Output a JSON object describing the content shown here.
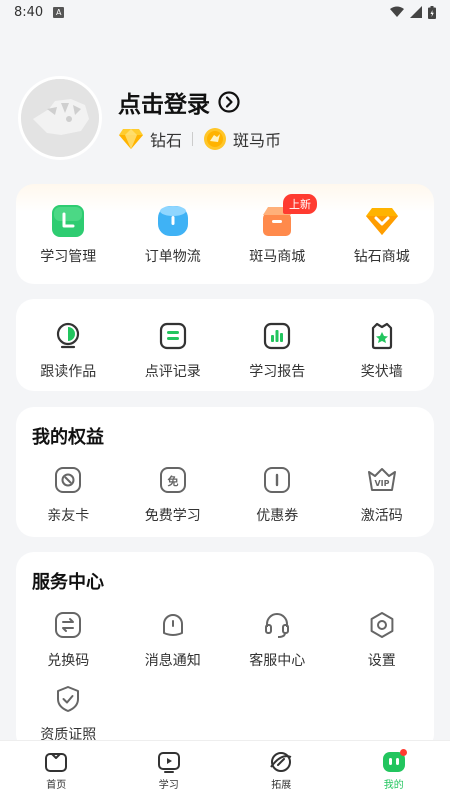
{
  "status_bar": {
    "time": "8:40",
    "notification": "A"
  },
  "profile": {
    "login_label": "点击登录",
    "diamond_label": "钻石",
    "coin_label": "斑马币"
  },
  "quick_menu": [
    {
      "label": "学习管理",
      "icon": "study-manage-icon"
    },
    {
      "label": "订单物流",
      "icon": "order-logistics-icon"
    },
    {
      "label": "斑马商城",
      "icon": "zebra-mall-icon",
      "badge": "上新"
    },
    {
      "label": "钻石商城",
      "icon": "diamond-mall-icon"
    }
  ],
  "works_menu": [
    {
      "label": "跟读作品",
      "icon": "follow-read-icon"
    },
    {
      "label": "点评记录",
      "icon": "review-record-icon"
    },
    {
      "label": "学习报告",
      "icon": "study-report-icon"
    },
    {
      "label": "奖状墙",
      "icon": "certificate-wall-icon"
    }
  ],
  "benefits": {
    "title": "我的权益",
    "items": [
      {
        "label": "亲友卡",
        "icon": "friend-card-icon"
      },
      {
        "label": "免费学习",
        "icon": "free-study-icon"
      },
      {
        "label": "优惠券",
        "icon": "coupon-icon"
      },
      {
        "label": "激活码",
        "icon": "activation-code-icon"
      }
    ]
  },
  "services": {
    "title": "服务中心",
    "items": [
      {
        "label": "兑换码",
        "icon": "redeem-code-icon"
      },
      {
        "label": "消息通知",
        "icon": "message-icon"
      },
      {
        "label": "客服中心",
        "icon": "headset-icon"
      },
      {
        "label": "设置",
        "icon": "settings-icon"
      },
      {
        "label": "资质证照",
        "icon": "certificate-icon"
      }
    ]
  },
  "bottom_nav": [
    {
      "label": "首页",
      "icon": "home-icon"
    },
    {
      "label": "学习",
      "icon": "play-icon"
    },
    {
      "label": "拓展",
      "icon": "explore-icon"
    },
    {
      "label": "我的",
      "icon": "mine-icon",
      "active": true
    }
  ],
  "colors": {
    "accent": "#22c55e",
    "badge": "#ff3b30",
    "background": "#f4f5f7"
  }
}
